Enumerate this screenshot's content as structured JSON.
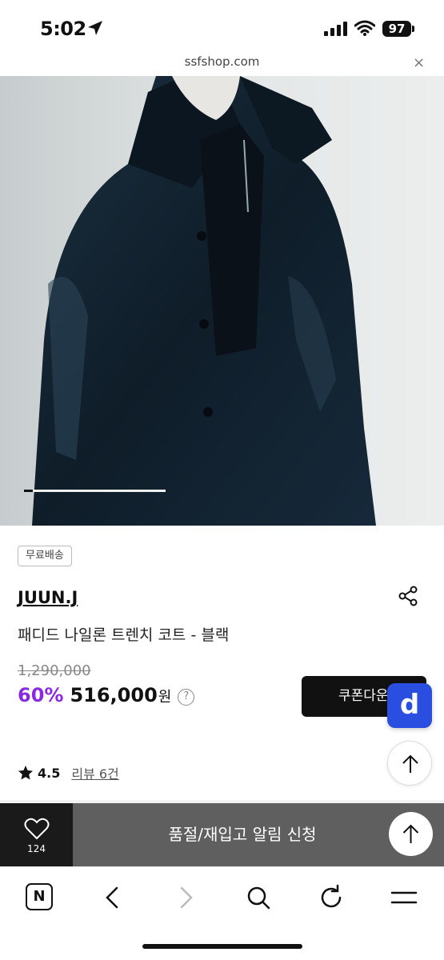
{
  "status_bar": {
    "time": "5:02",
    "battery": "97"
  },
  "browser": {
    "url": "ssfshop.com",
    "close_symbol": "×"
  },
  "product": {
    "badge": "무료배송",
    "brand": "JUUN.J",
    "name": "패디드 나일론 트렌치 코트 - 블랙",
    "original_price": "1,290,000",
    "discount": "60%",
    "sale_price": "516,000",
    "currency": "원",
    "help_symbol": "?",
    "rating": "4.5",
    "review_link": "리뷰 6건",
    "image_slider_progress": 0.06
  },
  "buttons": {
    "coupon": "쿠폰다운",
    "restock": "품절/재입고 알림 신청",
    "floating_app_letter": "d"
  },
  "wishlist": {
    "count": "124"
  },
  "toolbar": {
    "home_letter": "N"
  },
  "icons": [
    "location-arrow-icon",
    "signal-icon",
    "wifi-icon",
    "share-icon",
    "star-icon",
    "heart-icon",
    "arrow-up-icon",
    "back-icon",
    "forward-icon",
    "search-icon",
    "reload-icon",
    "menu-icon"
  ],
  "colors": {
    "discount": "#8a2be2",
    "app_fab": "#2a4fe0",
    "restock_bar": "#5f5f5f",
    "wish_bar": "#1a1a1a"
  }
}
